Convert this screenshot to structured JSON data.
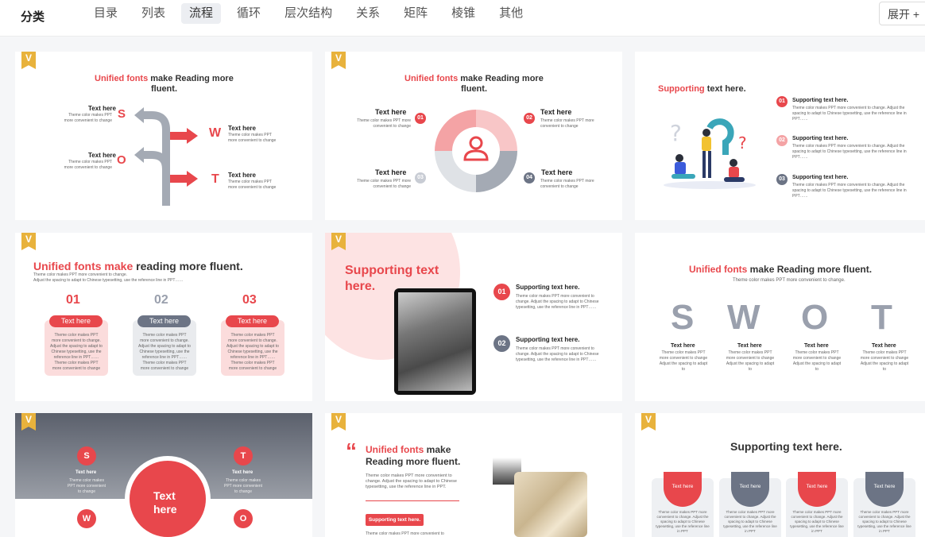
{
  "header": {
    "category_label": "分类",
    "tabs": [
      "目录",
      "列表",
      "流程",
      "循环",
      "层次结构",
      "关系",
      "矩阵",
      "棱锥",
      "其他"
    ],
    "active_tab": "流程",
    "expand_label": "展开 +"
  },
  "badge": "V",
  "c1": {
    "title_red": "Unified fonts",
    "title_black": "make Reading more",
    "title_l2": "fluent.",
    "item": "Text here",
    "desc1": "Theme color makes PPT",
    "desc2": "more convenient to change",
    "letters": [
      "S",
      "O",
      "W",
      "T"
    ]
  },
  "c2": {
    "title_red": "Unified fonts",
    "title_black": "make Reading more",
    "title_l2": "fluent.",
    "item": "Text here",
    "desc1": "Theme color makes PPT more",
    "desc2": "convenient to change",
    "nums": [
      "01",
      "02",
      "03",
      "04"
    ]
  },
  "c3": {
    "title_red": "Supporting",
    "title_black": "text here.",
    "item": "Supporting text here.",
    "desc1": "Theme color makes PPT more convenient to change. Adjust the spacing",
    "desc2": "to adapt to Chinese typesetting, use the reference line in PPT……",
    "nums": [
      "01",
      "02",
      "03"
    ]
  },
  "c4": {
    "title_red": "Unified fonts make",
    "title_black": "reading more fluent.",
    "sub1": "Theme color makes PPT more convenient to change.",
    "sub2": "Adjust the spacing to adapt to Chinese typesetting, use the reference line in PPT……",
    "nums": [
      "01",
      "02",
      "03"
    ],
    "pill": "Text here",
    "desc": "Theme color makes PPT more convenient to change. Adjust the spacing to adapt to Chinese typesetting, use the reference line in PPT…… Theme color makes PPT more convenient to change"
  },
  "c5": {
    "title_l1": "Supporting text",
    "title_l2": "here.",
    "item": "Supporting text here.",
    "desc": "Theme color makes PPT more convenient to change. Adjust the spacing to adapt to Chinese typesetting, use the reference line in PPT……",
    "nums": [
      "01",
      "02"
    ]
  },
  "c6": {
    "title_red": "Unified fonts",
    "title_black": "make Reading more fluent.",
    "sub": "Theme color makes PPT more convenient to change.",
    "letters": [
      "S",
      "W",
      "O",
      "T"
    ],
    "item": "Text here",
    "desc": "Theme color makes PPT more convenient to change Adjust the spacing to adapt to"
  },
  "c7": {
    "letters": [
      "S",
      "T",
      "W",
      "O"
    ],
    "item": "Text here",
    "desc": "Theme color makes PPT more convenient to change",
    "center_l1": "Text",
    "center_l2": "here"
  },
  "c8": {
    "quote": "“",
    "title_red": "Unified fonts",
    "title_black": "make",
    "title_l2": "Reading more fluent.",
    "desc": "Theme color makes PPT more convenient to change. Adjust the spacing to adapt to Chinese typesetting, use the reference line in PPT.",
    "btn": "Supporting text here.",
    "desc2": "Theme color makes PPT more convenient to"
  },
  "c9": {
    "title": "Supporting text here.",
    "label": "Text here",
    "desc": "Theme color makes PPT more convenient to change. Adjust the spacing to adapt to Chinese typesetting, use the reference line in PPT"
  },
  "colors": {
    "accent": "#e8474c",
    "grey": "#6c7485",
    "light_grey": "#c8ccd4",
    "badge": "#e8b23c"
  }
}
